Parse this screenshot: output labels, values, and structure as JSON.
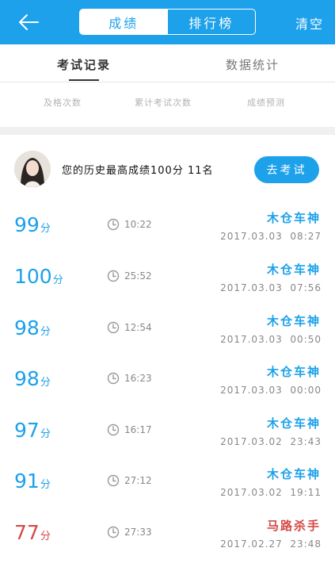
{
  "header": {
    "tabs": [
      "成绩",
      "排行榜"
    ],
    "active_tab": "成绩",
    "clear_label": "清空"
  },
  "subtabs": [
    "考试记录",
    "数据统计"
  ],
  "stats": [
    "及格次数",
    "累计考试次数",
    "成绩预测"
  ],
  "profile": {
    "best_text": "您的历史最高成绩100分  11名",
    "go_button": "去考试"
  },
  "records": [
    {
      "score": "99",
      "unit": "分",
      "duration": "10:22",
      "title": "木仓车神",
      "date": "2017.03.03  08:27",
      "color": "#1da1ea"
    },
    {
      "score": "100",
      "unit": "分",
      "duration": "25:52",
      "title": "木仓车神",
      "date": "2017.03.03  07:56",
      "color": "#1da1ea"
    },
    {
      "score": "98",
      "unit": "分",
      "duration": "12:54",
      "title": "木仓车神",
      "date": "2017.03.03  00:50",
      "color": "#1da1ea"
    },
    {
      "score": "98",
      "unit": "分",
      "duration": "16:23",
      "title": "木仓车神",
      "date": "2017.03.03  00:00",
      "color": "#1da1ea"
    },
    {
      "score": "97",
      "unit": "分",
      "duration": "16:17",
      "title": "木仓车神",
      "date": "2017.03.02  23:43",
      "color": "#1da1ea"
    },
    {
      "score": "91",
      "unit": "分",
      "duration": "27:12",
      "title": "木仓车神",
      "date": "2017.03.02  19:11",
      "color": "#1da1ea"
    },
    {
      "score": "77",
      "unit": "分",
      "duration": "27:33",
      "title": "马路杀手",
      "date": "2017.02.27  23:48",
      "color": "#d44a46"
    }
  ],
  "colors": {
    "accent": "#1da1ea",
    "fail": "#d44a46"
  }
}
